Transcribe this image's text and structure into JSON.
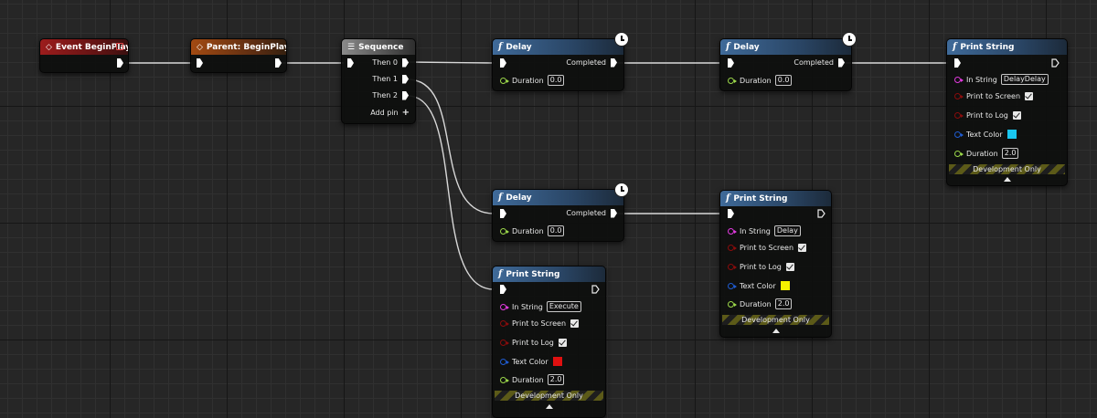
{
  "nodes": {
    "event_beginplay": {
      "title": "Event BeginPlay"
    },
    "parent_beginplay": {
      "title": "Parent: BeginPlay"
    },
    "sequence": {
      "title": "Sequence",
      "outputs": [
        "Then 0",
        "Then 1",
        "Then 2"
      ],
      "add_pin": "Add pin"
    },
    "delay_1": {
      "title": "Delay",
      "completed": "Completed",
      "duration_label": "Duration",
      "duration": "0.0"
    },
    "delay_2": {
      "title": "Delay",
      "completed": "Completed",
      "duration_label": "Duration",
      "duration": "0.0"
    },
    "delay_3": {
      "title": "Delay",
      "completed": "Completed",
      "duration_label": "Duration",
      "duration": "0.0"
    },
    "print_1": {
      "title": "Print String",
      "in_string_label": "In String",
      "in_string": "DelayDelay",
      "print_screen": "Print to Screen",
      "print_log": "Print to Log",
      "text_color_label": "Text Color",
      "text_color": "#19c6f0",
      "duration_label": "Duration",
      "duration": "2.0",
      "dev_only": "Development Only"
    },
    "print_2": {
      "title": "Print String",
      "in_string_label": "In String",
      "in_string": "Delay",
      "print_screen": "Print to Screen",
      "print_log": "Print to Log",
      "text_color_label": "Text Color",
      "text_color": "#f6f200",
      "duration_label": "Duration",
      "duration": "2.0",
      "dev_only": "Development Only"
    },
    "print_3": {
      "title": "Print String",
      "in_string_label": "In String",
      "in_string": "Execute",
      "print_screen": "Print to Screen",
      "print_log": "Print to Log",
      "text_color_label": "Text Color",
      "text_color": "#e01010",
      "duration_label": "Duration",
      "duration": "2.0",
      "dev_only": "Development Only"
    }
  }
}
